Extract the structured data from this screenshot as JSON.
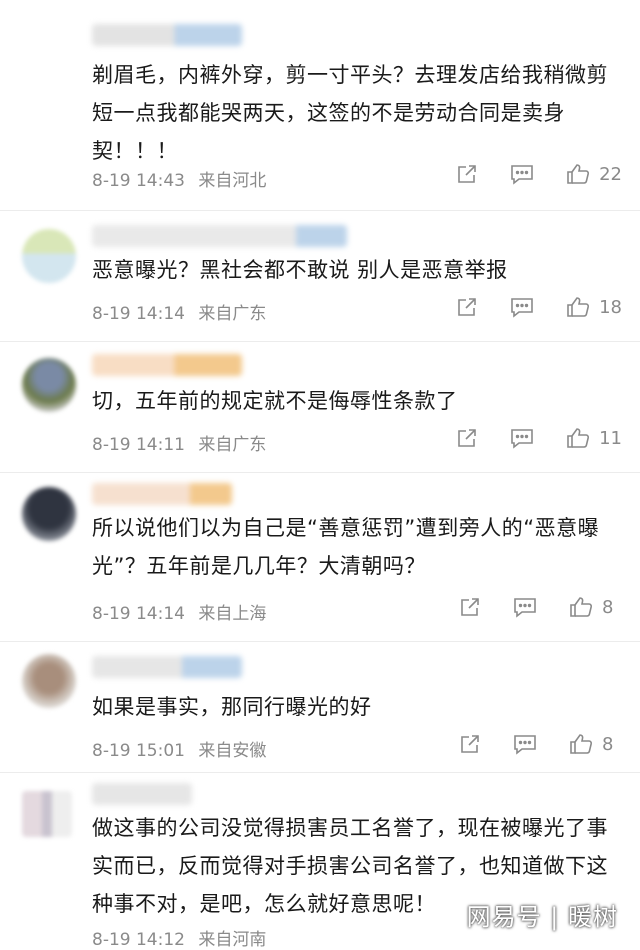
{
  "comments": [
    {
      "text": "剃眉毛，内裤外穿，剪一寸平头？去理发店给我稍微剪短一点我都能哭两天，这签的不是劳动合同是卖身契！！！",
      "date": "8-19 14:43",
      "location": "来自河北",
      "likes": "22"
    },
    {
      "text": "恶意曝光？黑社会都不敢说 别人是恶意举报",
      "date": "8-19 14:14",
      "location": "来自广东",
      "likes": "18"
    },
    {
      "text": "切，五年前的规定就不是侮辱性条款了",
      "date": "8-19 14:11",
      "location": "来自广东",
      "likes": "11"
    },
    {
      "text": "所以说他们以为自己是“善意惩罚”遭到旁人的“恶意曝光”？五年前是几几年？大清朝吗？",
      "date": "8-19 14:14",
      "location": "来自上海",
      "likes": "8"
    },
    {
      "text": "如果是事实，那同行曝光的好",
      "date": "8-19 15:01",
      "location": "来自安徽",
      "likes": "8"
    },
    {
      "text": "做这事的公司没觉得损害员工名誉了，现在被曝光了事实而已，反而觉得对手损害公司名誉了，也知道做下这种事不对，是吧，怎么就好意思呢！",
      "date": "8-19 14:12",
      "location": "来自河南",
      "likes": ""
    }
  ],
  "watermark": "网易号 | 暖树",
  "colors": {
    "meta": "#8a8a8a",
    "icon": "#8a8a8a",
    "divider": "#ececec"
  }
}
